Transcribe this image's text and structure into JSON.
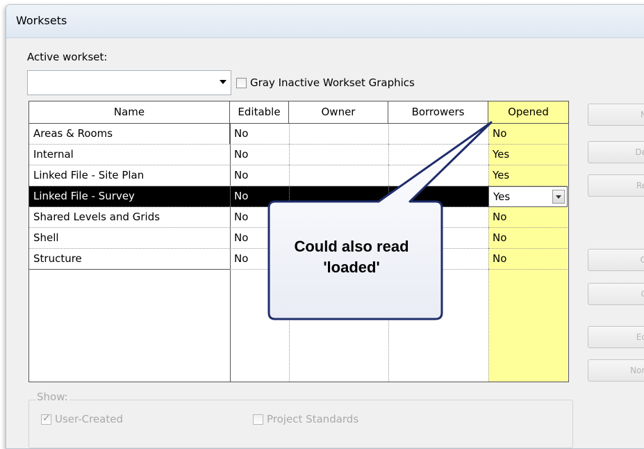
{
  "window": {
    "title": "Worksets"
  },
  "active_workset": {
    "label": "Active workset:",
    "value": ""
  },
  "gray_inactive": {
    "label": "Gray Inactive Workset Graphics",
    "checked": false
  },
  "table": {
    "columns": [
      "Name",
      "Editable",
      "Owner",
      "Borrowers",
      "Opened"
    ],
    "rows": [
      {
        "name": "Areas & Rooms",
        "editable": "No",
        "owner": "",
        "borrowers": "",
        "opened": "No"
      },
      {
        "name": "Internal",
        "editable": "No",
        "owner": "",
        "borrowers": "",
        "opened": "Yes"
      },
      {
        "name": "Linked File - Site Plan",
        "editable": "No",
        "owner": "",
        "borrowers": "",
        "opened": "Yes"
      },
      {
        "name": "Linked File - Survey",
        "editable": "No",
        "owner": "",
        "borrowers": "",
        "opened": "Yes",
        "selected": true
      },
      {
        "name": "Shared Levels and Grids",
        "editable": "No",
        "owner": "",
        "borrowers": "",
        "opened": "No"
      },
      {
        "name": "Shell",
        "editable": "No",
        "owner": "",
        "borrowers": "",
        "opened": "No"
      },
      {
        "name": "Structure",
        "editable": "No",
        "owner": "",
        "borrowers": "",
        "opened": "No"
      }
    ]
  },
  "side_buttons": [
    "N",
    "De",
    "Re",
    "O",
    "C",
    "Ed",
    "Non"
  ],
  "show": {
    "label": "Show:",
    "user_created": {
      "label": "User-Created",
      "checked": true
    },
    "project_standards": {
      "label": "Project Standards",
      "checked": false
    }
  },
  "callout": {
    "line1": "Could also read",
    "line2": "'loaded'"
  },
  "colors": {
    "opened_highlight": "#ffff9a",
    "selection": "#000000",
    "callout_border": "#1f2d6b"
  }
}
